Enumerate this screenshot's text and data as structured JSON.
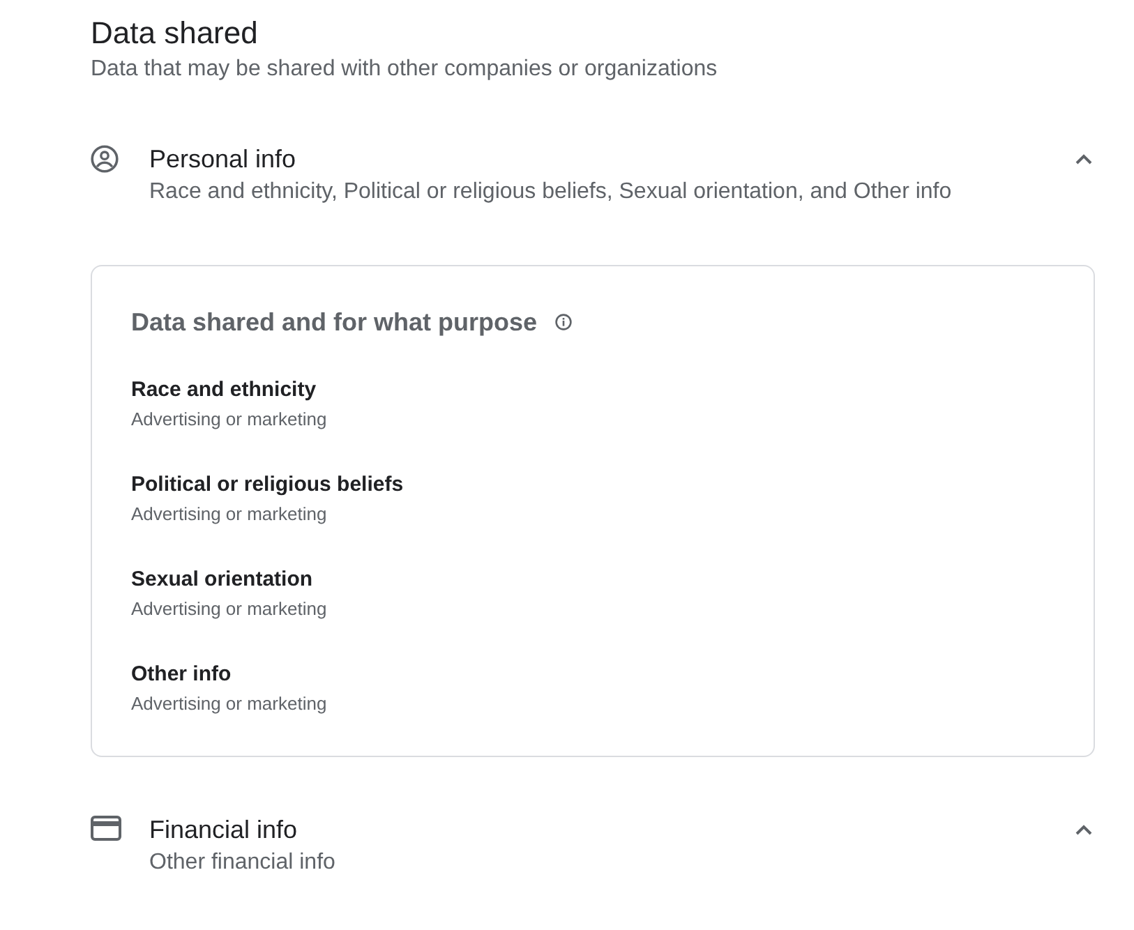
{
  "section": {
    "title": "Data shared",
    "subtitle": "Data that may be shared with other companies or organizations"
  },
  "categories": [
    {
      "kind": "personal",
      "title": "Personal info",
      "summary": "Race and ethnicity, Political or religious beliefs, Sexual orientation, and Other info",
      "expanded": true,
      "details": {
        "heading": "Data shared and for what purpose",
        "items": [
          {
            "name": "Race and ethnicity",
            "purpose": "Advertising or marketing"
          },
          {
            "name": "Political or religious beliefs",
            "purpose": "Advertising or marketing"
          },
          {
            "name": "Sexual orientation",
            "purpose": "Advertising or marketing"
          },
          {
            "name": "Other info",
            "purpose": "Advertising or marketing"
          }
        ]
      }
    },
    {
      "kind": "financial",
      "title": "Financial info",
      "summary": "Other financial info",
      "expanded": true
    }
  ]
}
